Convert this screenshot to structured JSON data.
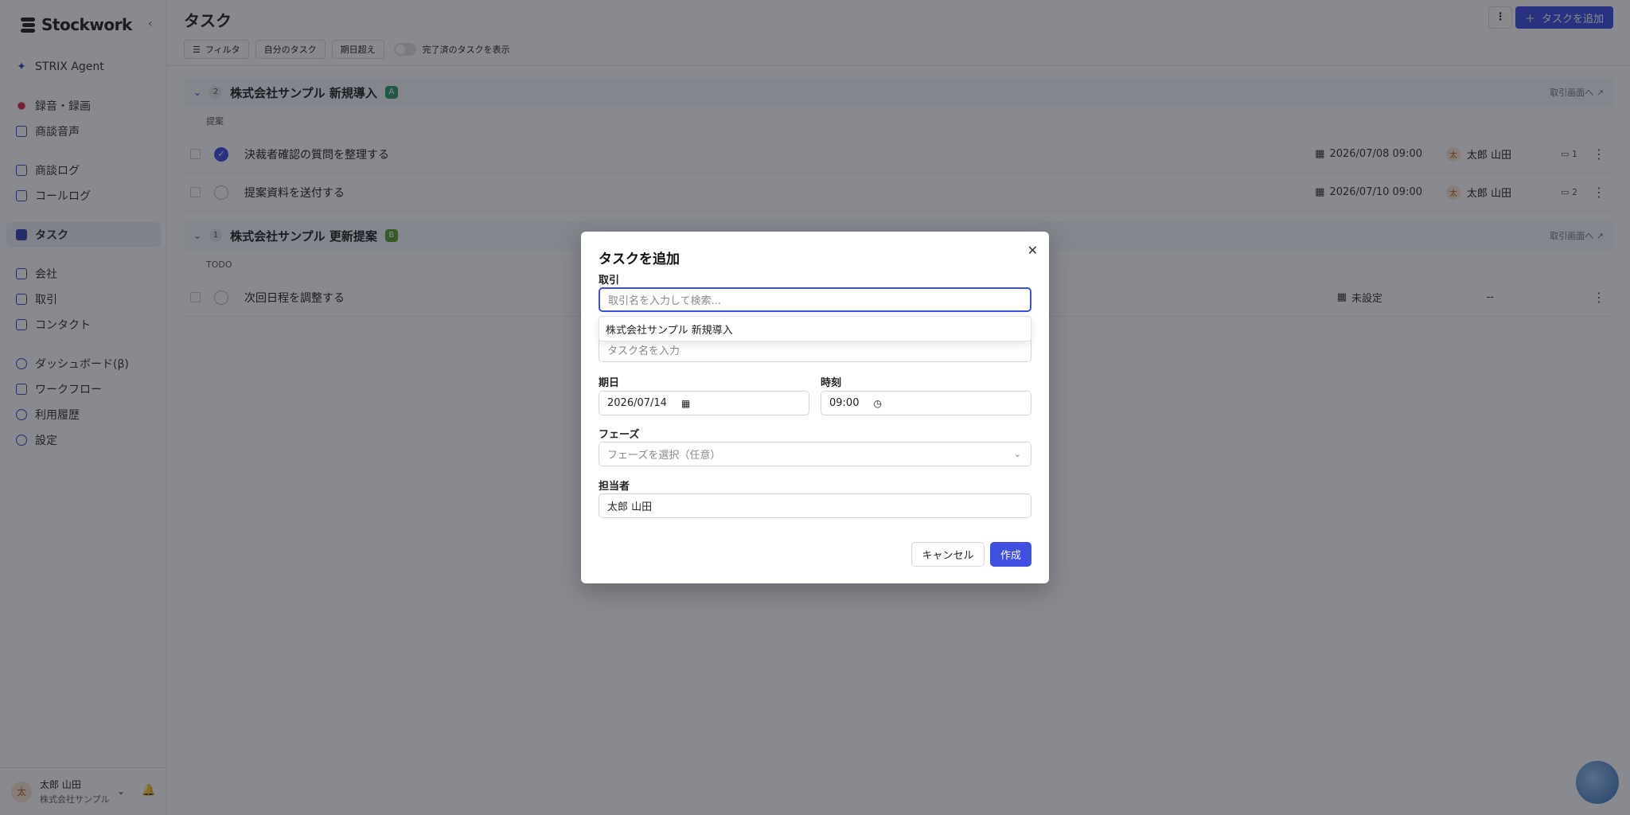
{
  "sidebar": {
    "brand": "Stockwork",
    "collapse_icon": "chevron-left-icon",
    "items": [
      {
        "label": "STRIX Agent",
        "icon": "sparkle-icon"
      },
      {
        "label": "録音・録画",
        "icon": "record-icon"
      },
      {
        "label": "商談音声",
        "icon": "folder-icon"
      },
      {
        "label": "商談ログ",
        "icon": "document-icon"
      },
      {
        "label": "コールログ",
        "icon": "phone-icon"
      },
      {
        "label": "タスク",
        "icon": "checkbox-icon",
        "active": true
      },
      {
        "label": "会社",
        "icon": "building-icon"
      },
      {
        "label": "取引",
        "icon": "deal-icon"
      },
      {
        "label": "コンタクト",
        "icon": "contact-icon"
      },
      {
        "label": "ダッシュボード(β)",
        "icon": "dashboard-icon"
      },
      {
        "label": "ワークフロー",
        "icon": "workflow-icon"
      },
      {
        "label": "利用履歴",
        "icon": "history-icon"
      },
      {
        "label": "設定",
        "icon": "gear-icon"
      }
    ],
    "user": {
      "initial": "太",
      "name": "太郎 山田",
      "org": "株式会社サンプル"
    }
  },
  "header": {
    "title": "タスク",
    "add_button": "タスクを追加",
    "add_icon": "plus-icon",
    "more_icon": "kebab-icon"
  },
  "toolbar": {
    "filter": "フィルタ",
    "my_tasks": "自分のタスク",
    "overdue": "期日超え",
    "show_completed": "完了済のタスクを表示",
    "show_completed_on": false
  },
  "groups": [
    {
      "count": "2",
      "title": "株式会社サンプル 新規導入",
      "badge": "A",
      "badge_color": "#2e9d6a",
      "link": "取引画面へ",
      "phase": "提案",
      "tasks": [
        {
          "name": "決裁者確認の質問を整理する",
          "done": true,
          "date": "2026/07/08 09:00",
          "owner_initial": "太",
          "owner": "太郎 山田",
          "comments": "1"
        },
        {
          "name": "提案資料を送付する",
          "done": false,
          "date": "2026/07/10 09:00",
          "owner_initial": "太",
          "owner": "太郎 山田",
          "comments": "2"
        }
      ]
    },
    {
      "count": "1",
      "title": "株式会社サンプル 更新提案",
      "badge": "B",
      "badge_color": "#5a9d2e",
      "link": "取引画面へ",
      "phase": "TODO",
      "tasks": [
        {
          "name": "次回日程を調整する",
          "done": false,
          "date": "未設定",
          "owner": "--"
        }
      ]
    }
  ],
  "modal": {
    "title": "タスクを追加",
    "close_icon": "close-icon",
    "deal_label": "取引",
    "deal_placeholder": "取引名を入力して検索...",
    "deal_suggestion": "株式会社サンプル 新規導入",
    "task_placeholder": "タスク名を入力",
    "due_label": "期日",
    "due_value": "2026/07/14",
    "time_label": "時刻",
    "time_value": "09:00",
    "phase_label": "フェーズ",
    "phase_placeholder": "フェーズを選択（任意）",
    "assignee_label": "担当者",
    "assignee_value": "太郎 山田",
    "cancel": "キャンセル",
    "create": "作成"
  }
}
